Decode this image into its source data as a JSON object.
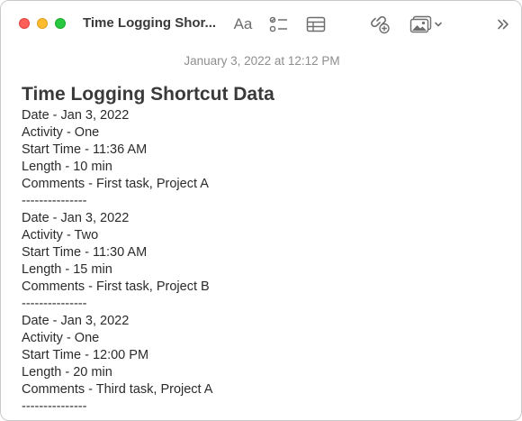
{
  "window": {
    "title": "Time Logging Shor...",
    "format_label": "Aa"
  },
  "note": {
    "date": "January 3, 2022 at 12:12 PM",
    "heading": "Time Logging Shortcut Data",
    "lines": [
      "Date - Jan 3, 2022",
      "Activity - One",
      "Start Time - 11:36 AM",
      "Length - 10 min",
      "Comments - First task, Project A",
      "---------------",
      "Date - Jan 3, 2022",
      "Activity - Two",
      "Start Time - 11:30 AM",
      "Length - 15 min",
      "Comments - First task, Project B",
      "---------------",
      "Date - Jan 3, 2022",
      "Activity - One",
      "Start Time - 12:00 PM",
      "Length - 20 min",
      "Comments - Third task, Project A",
      "---------------"
    ]
  },
  "icons": {
    "close": "close-icon",
    "minimize": "minimize-icon",
    "zoom": "zoom-icon",
    "checklist": "checklist-icon",
    "table": "table-icon",
    "collaborate": "collaborate-icon",
    "media": "photo-icon",
    "more": "chevron-double-right-icon"
  },
  "colors": {
    "close": "#fe5f57",
    "minimize": "#febc2e",
    "zoom": "#28c840",
    "toolbar_icon": "#6e6e6e",
    "date_text": "#8e8e8e"
  }
}
